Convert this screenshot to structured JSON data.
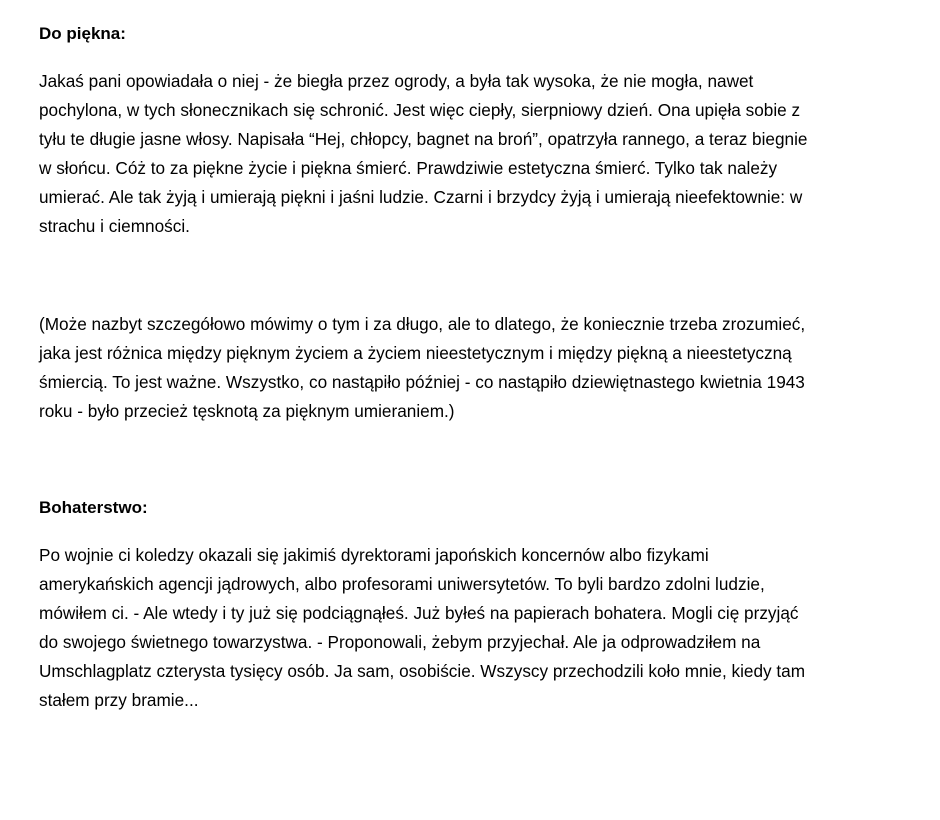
{
  "sections": [
    {
      "heading": "Do piękna:",
      "paragraphs": [
        {
          "lines": [
            "Jakaś pani opowiadała o niej - że biegła przez ogrody, a była tak wysoka, że nie mogła, nawet",
            "pochylona, w tych słonecznikach się schronić. Jest więc ciepły, sierpniowy dzień. Ona upięła sobie z",
            "tyłu te długie jasne włosy. Napisała “Hej, chłopcy, bagnet na broń”, opatrzyła rannego, a teraz biegnie",
            "w słońcu. Cóż to za piękne życie i piękna śmierć. Prawdziwie estetyczna śmierć. Tylko tak należy",
            "umierać. Ale tak żyją i umierają piękni i jaśni ludzie. Czarni i brzydcy żyją i umierają nieefektownie: w",
            "strachu i ciemności."
          ]
        },
        {
          "lines": [
            "(Może nazbyt szczegółowo mówimy o tym i za długo, ale to dlatego, że koniecznie trzeba zrozumieć,",
            "jaka jest różnica między pięknym życiem a życiem nieestetycznym i między piękną a nieestetyczną",
            "śmiercią. To jest ważne. Wszystko, co nastąpiło później - co nastąpiło dziewiętnastego kwietnia 1943",
            "roku - było przecież tęsknotą za pięknym umieraniem.)"
          ]
        }
      ]
    },
    {
      "heading": "Bohaterstwo:",
      "paragraphs": [
        {
          "lines": [
            "Po wojnie ci koledzy okazali się jakimiś dyrektorami japońskich koncernów albo fizykami",
            "amerykańskich agencji jądrowych, albo profesorami uniwersytetów. To byli bardzo zdolni ludzie,",
            "mówiłem ci. - Ale wtedy i ty już się podciągnąłeś. Już byłeś na papierach bohatera. Mogli cię przyjąć",
            "do swojego świetnego towarzystwa. - Proponowali, żebym przyjechał. Ale ja odprowadziłem na",
            "Umschlagplatz czterysta tysięcy osób. Ja sam, osobiście. Wszyscy przechodzili koło mnie, kiedy tam",
            "stałem przy bramie..."
          ]
        }
      ]
    }
  ]
}
